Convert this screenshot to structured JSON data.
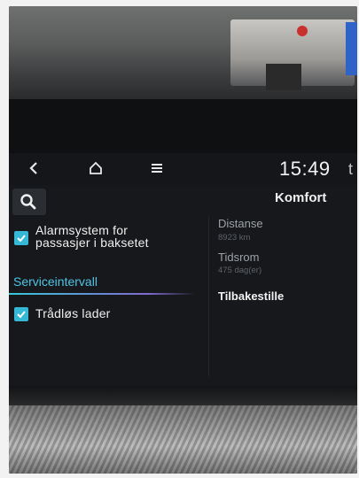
{
  "statusbar": {
    "back_icon": "back-icon",
    "home_icon": "home-icon",
    "menu_icon": "menu-icon",
    "time": "15:49",
    "time_extra": "t"
  },
  "header": {
    "search_icon": "search-icon",
    "title": "Komfort"
  },
  "left_panel": {
    "items": [
      {
        "label_line1": "Alarmsystem for",
        "label_line2": "passasjer i baksetet",
        "checked": true
      },
      {
        "label": "Serviceintervall",
        "selected": true
      },
      {
        "label": "Trådløs lader",
        "checked": true
      }
    ]
  },
  "right_panel": {
    "distance_label": "Distanse",
    "distance_value": "8923 km",
    "time_label": "Tidsrom",
    "time_value": "475 dag(er)",
    "reset_label": "Tilbakestille"
  },
  "colors": {
    "accent_cyan": "#35b7d6",
    "selected_text": "#4fc4e6",
    "underline_purple": "#7f6ad0",
    "screen_bg": "#16181b"
  }
}
